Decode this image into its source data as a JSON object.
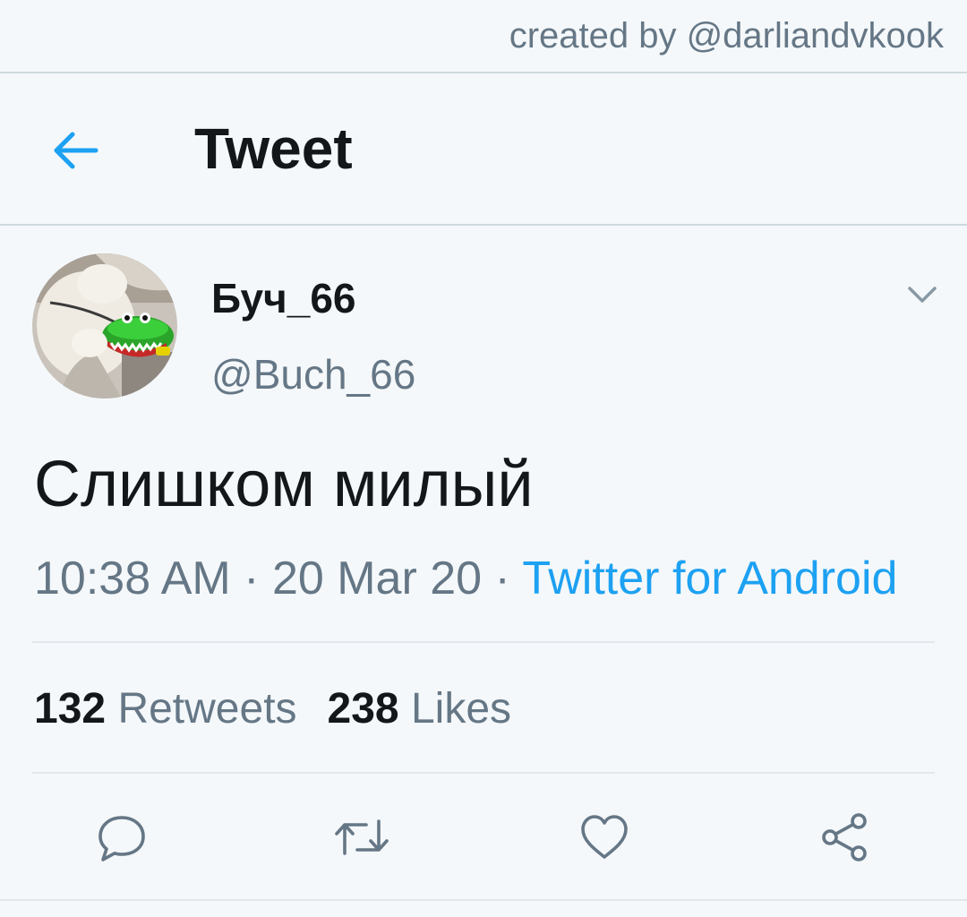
{
  "watermark": "created by @darliandvkook",
  "header": {
    "title": "Tweet",
    "back_icon": "arrow-left-icon"
  },
  "tweet": {
    "display_name": "Буч_66",
    "handle": "@Buch_66",
    "text": "Слишком милый",
    "time": "10:38 AM",
    "date": "20 Mar 20",
    "source": "Twitter for Android",
    "separator": " · ",
    "caret_icon": "chevron-down-icon"
  },
  "stats": {
    "retweets_count": "132",
    "retweets_label": "Retweets",
    "likes_count": "238",
    "likes_label": "Likes"
  },
  "actions": [
    "reply-icon",
    "retweet-icon",
    "like-icon",
    "share-icon"
  ],
  "colors": {
    "accent": "#1da1f2",
    "text_primary": "#14171a",
    "text_secondary": "#657786",
    "background": "#f5f8fa",
    "divider": "#e1e8ed"
  }
}
